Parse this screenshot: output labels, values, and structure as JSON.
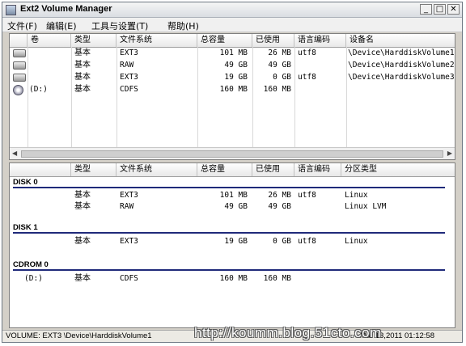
{
  "window": {
    "title": "Ext2 Volume Manager",
    "controls": {
      "minimize": "_",
      "maximize": "□",
      "close": "✕"
    }
  },
  "menu": [
    "文件(F)",
    "编辑(E)",
    "工具与设置(T)",
    "帮助(H)"
  ],
  "volumes": {
    "columns": [
      "卷",
      "类型",
      "文件系统",
      "总容量",
      "已使用",
      "语言编码",
      "设备名"
    ],
    "rows": [
      {
        "icon": "hard-disk-icon",
        "volume": "",
        "type": "基本",
        "fs": "EXT3",
        "total": "101 MB",
        "used": "26 MB",
        "codepage": "utf8",
        "device": "\\Device\\HarddiskVolume1"
      },
      {
        "icon": "hard-disk-icon",
        "volume": "",
        "type": "基本",
        "fs": "RAW",
        "total": "49 GB",
        "used": "49 GB",
        "codepage": "",
        "device": "\\Device\\HarddiskVolume2"
      },
      {
        "icon": "hard-disk-icon",
        "volume": "",
        "type": "基本",
        "fs": "EXT3",
        "total": "19 GB",
        "used": "0 GB",
        "codepage": "utf8",
        "device": "\\Device\\HarddiskVolume3"
      },
      {
        "icon": "cdrom-icon",
        "volume": "(D:)",
        "type": "基本",
        "fs": "CDFS",
        "total": "160 MB",
        "used": "160 MB",
        "codepage": "",
        "device": ""
      }
    ]
  },
  "disks": {
    "columns": [
      "",
      "类型",
      "文件系统",
      "总容量",
      "已使用",
      "语言编码",
      "分区类型"
    ],
    "groups": [
      {
        "name": "DISK 0",
        "partitions": [
          {
            "volume": "",
            "type": "基本",
            "fs": "EXT3",
            "total": "101 MB",
            "used": "26 MB",
            "codepage": "utf8",
            "ptype": "Linux"
          },
          {
            "volume": "",
            "type": "基本",
            "fs": "RAW",
            "total": "49 GB",
            "used": "49 GB",
            "codepage": "",
            "ptype": "Linux LVM"
          }
        ]
      },
      {
        "name": "DISK 1",
        "partitions": [
          {
            "volume": "",
            "type": "基本",
            "fs": "EXT3",
            "total": "19 GB",
            "used": "0 GB",
            "codepage": "utf8",
            "ptype": "Linux"
          }
        ]
      },
      {
        "name": "CDROM 0",
        "partitions": [
          {
            "volume": "(D:)",
            "type": "基本",
            "fs": "CDFS",
            "total": "160 MB",
            "used": "160 MB",
            "codepage": "",
            "ptype": ""
          }
        ]
      }
    ]
  },
  "status": {
    "text": "VOLUME:  EXT3 \\Device\\HarddiskVolume1",
    "time": "Mar 13,2011 01:12:58"
  },
  "watermark": "http://koumm.blog.51cto.com"
}
